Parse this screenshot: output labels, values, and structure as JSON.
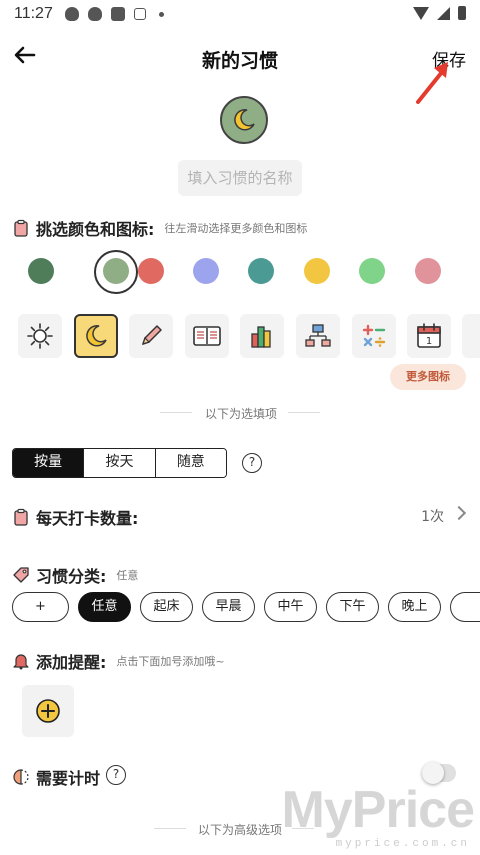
{
  "status_bar": {
    "time": "11:27"
  },
  "header": {
    "title": "新的习惯",
    "save_label": "保存"
  },
  "name_input": {
    "placeholder": "填入习惯的名称"
  },
  "color_section": {
    "title": "挑选颜色和图标:",
    "hint": "往左滑动选择更多颜色和图标",
    "colors": [
      "#4f7d5a",
      "#8fae86",
      "#e06a62",
      "#9da4ee",
      "#4c9a94",
      "#f3c642",
      "#7fd48a",
      "#e0939a"
    ],
    "selected_color": "#8fae86"
  },
  "icons": {
    "names": [
      "sun-icon",
      "moon-icon",
      "pencil-icon",
      "book-icon",
      "books-icon",
      "network-icon",
      "calculator-icon",
      "calendar-icon"
    ],
    "calendar_day": "1",
    "more_label": "更多图标"
  },
  "optional_divider": "以下为选填项",
  "mode_tabs": {
    "tabs": [
      "按量",
      "按天",
      "随意"
    ],
    "active": "按量",
    "help": "?"
  },
  "daily_checkin": {
    "title": "每天打卡数量:",
    "value": "1次"
  },
  "category": {
    "title": "习惯分类:",
    "current": "任意",
    "chips": [
      "+",
      "任意",
      "起床",
      "早晨",
      "中午",
      "下午",
      "晚上"
    ],
    "active_chip": "任意"
  },
  "reminder": {
    "title": "添加提醒:",
    "hint": "点击下面加号添加哦~"
  },
  "timer": {
    "title": "需要计时",
    "help": "?",
    "enabled": false
  },
  "advanced_divider": "以下为高级选项",
  "watermark": {
    "brand": "MyPrice",
    "url": "myprice.com.cn"
  }
}
